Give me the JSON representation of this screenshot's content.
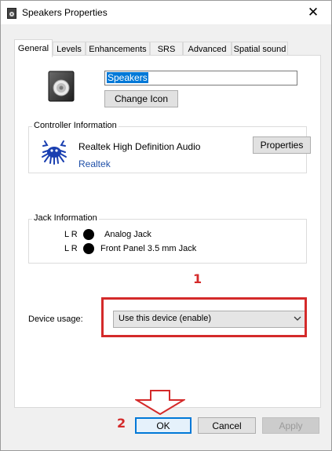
{
  "window": {
    "title": "Speakers Properties",
    "close_glyph": "✕"
  },
  "tabs": [
    {
      "label": "General",
      "active": true
    },
    {
      "label": "Levels",
      "active": false
    },
    {
      "label": "Enhancements",
      "active": false
    },
    {
      "label": "SRS",
      "active": false
    },
    {
      "label": "Advanced",
      "active": false
    },
    {
      "label": "Spatial sound",
      "active": false
    }
  ],
  "general": {
    "device_name_value": "Speakers",
    "change_icon_label": "Change Icon"
  },
  "controller": {
    "group_label": "Controller Information",
    "name": "Realtek High Definition Audio",
    "vendor": "Realtek",
    "properties_label": "Properties"
  },
  "jack": {
    "group_label": "Jack Information",
    "rows": [
      {
        "lr": "L R",
        "name": "Analog Jack"
      },
      {
        "lr": "L R",
        "name": "Front Panel 3.5 mm Jack"
      }
    ]
  },
  "usage": {
    "label": "Device usage:",
    "selected": "Use this device (enable)"
  },
  "annotations": {
    "step1": "1",
    "step2": "2",
    "color": "#d42a2a"
  },
  "buttons": {
    "ok": "OK",
    "cancel": "Cancel",
    "apply": "Apply"
  },
  "icons": {
    "title": "speaker-icon",
    "device": "speaker-icon",
    "controller": "realtek-crab-icon",
    "dropdown": "chevron-down-icon",
    "annotation_arrow": "arrow-down-icon"
  }
}
